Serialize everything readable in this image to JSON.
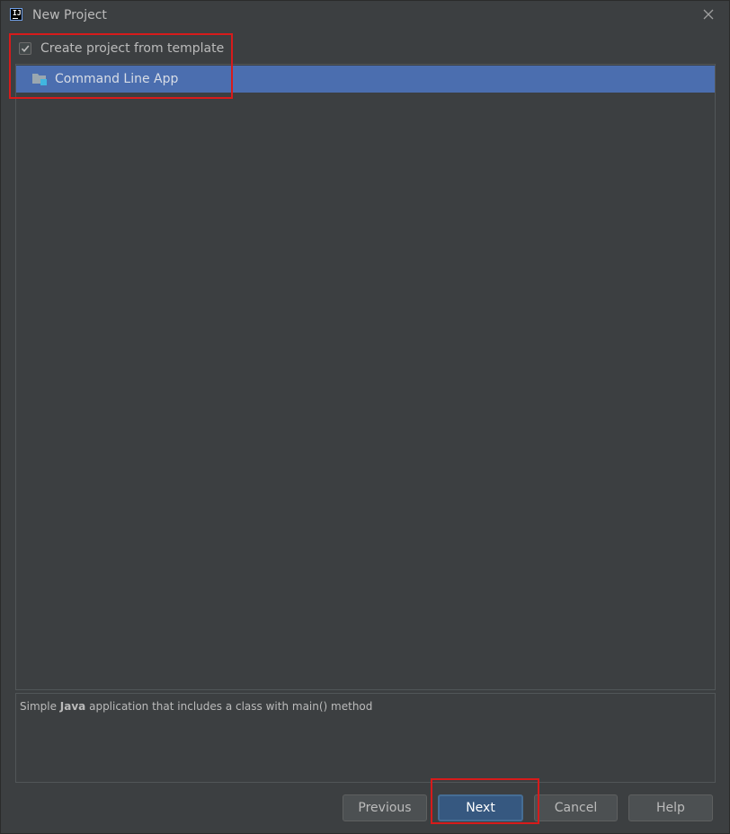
{
  "window": {
    "title": "New Project",
    "app_icon": "intellij-idea-icon",
    "close_icon": "close-icon"
  },
  "template_option": {
    "checkbox_label": "Create project from template",
    "checked": true
  },
  "templates": [
    {
      "label": "Command Line App",
      "icon": "folder-module-icon",
      "selected": true
    }
  ],
  "description": {
    "prefix": "Simple ",
    "bold": "Java",
    "suffix": " application that includes a class with main() method"
  },
  "buttons": {
    "previous": "Previous",
    "next": "Next",
    "cancel": "Cancel",
    "help": "Help"
  },
  "colors": {
    "background": "#3c3f41",
    "selection": "#4b6eaf",
    "primary_button": "#365880",
    "annotation_red": "#d71b1b"
  }
}
